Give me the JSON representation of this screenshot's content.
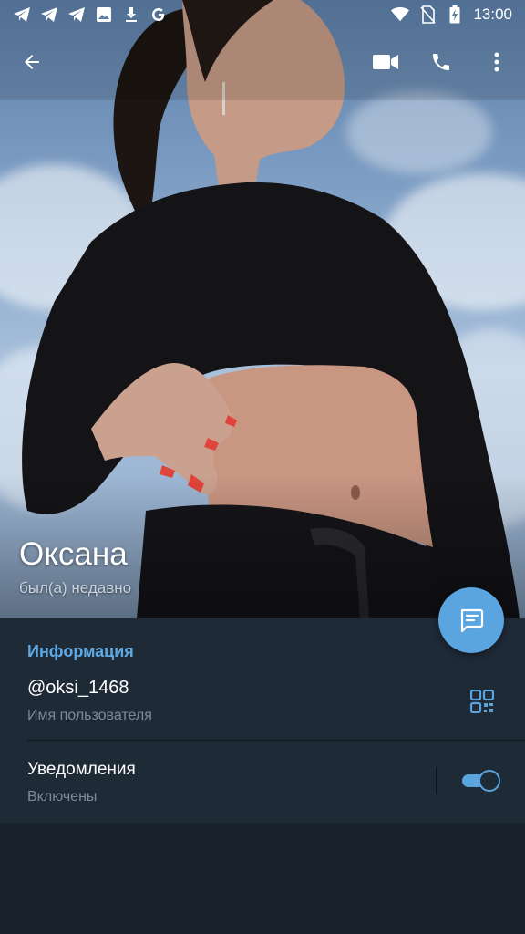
{
  "status_bar": {
    "time": "13:00",
    "left_icons": [
      "telegram-icon",
      "telegram-icon",
      "telegram-icon",
      "image-icon",
      "download-icon",
      "google-icon"
    ],
    "right_icons": [
      "wifi-icon",
      "no-sim-icon",
      "battery-charging-icon"
    ]
  },
  "toolbar": {
    "back_icon": "back-arrow-icon",
    "video_icon": "video-call-icon",
    "call_icon": "phone-icon",
    "more_icon": "more-vert-icon"
  },
  "profile": {
    "name": "Оксана",
    "status": "был(а) недавно"
  },
  "info": {
    "section_title": "Информация",
    "username": "@oksi_1468",
    "username_label": "Имя пользователя",
    "notifications_label": "Уведомления",
    "notifications_state": "Включены",
    "notifications_on": true
  },
  "colors": {
    "accent": "#5aa4e0",
    "panel": "#1f2a37",
    "background": "#18222d"
  }
}
